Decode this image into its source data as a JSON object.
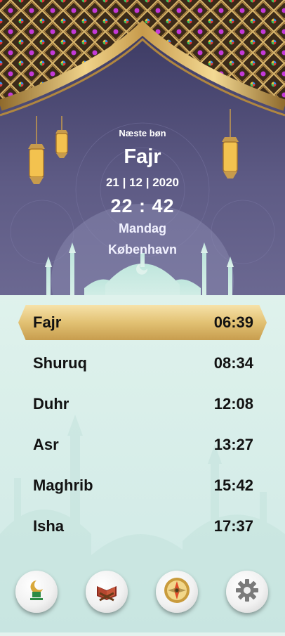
{
  "header": {
    "next_prayer_label": "Næste bøn",
    "next_prayer_name": "Fajr",
    "date": "21  |  12  |  2020",
    "time": "22 : 42",
    "weekday": "Mandag",
    "city": "København"
  },
  "prayers": [
    {
      "name": "Fajr",
      "time": "06:39",
      "active": true
    },
    {
      "name": "Shuruq",
      "time": "08:34",
      "active": false
    },
    {
      "name": "Duhr",
      "time": "12:08",
      "active": false
    },
    {
      "name": "Asr",
      "time": "13:27",
      "active": false
    },
    {
      "name": "Maghrib",
      "time": "15:42",
      "active": false
    },
    {
      "name": "Isha",
      "time": "17:37",
      "active": false
    }
  ],
  "bottom_nav": [
    {
      "icon": "logo-icon"
    },
    {
      "icon": "quran-icon"
    },
    {
      "icon": "compass-icon"
    },
    {
      "icon": "gear-icon"
    }
  ],
  "colors": {
    "gold": "#d9b35f",
    "purple_sky": "#5e5b85",
    "mint_background": "#dff2ec"
  }
}
